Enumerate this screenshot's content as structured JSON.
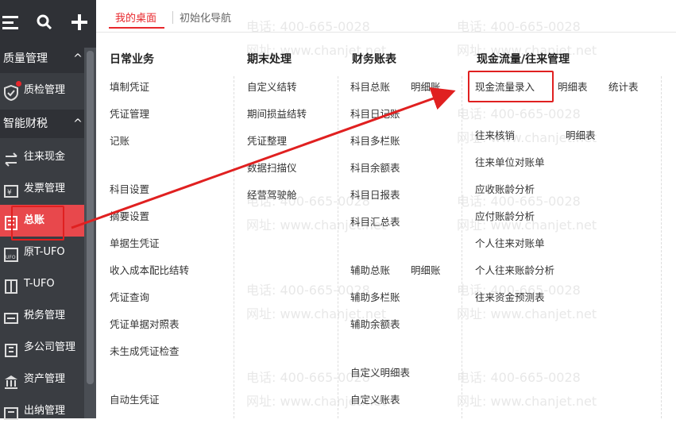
{
  "sidebar": {
    "sections": [
      {
        "label": "质量管理",
        "chevron": "^"
      },
      {
        "label": "智能财税",
        "chevron": "^"
      }
    ],
    "items": [
      {
        "label": "质检管理",
        "icon": "shield-check-icon"
      },
      {
        "label": "往来现金",
        "icon": "exchange-icon"
      },
      {
        "label": "发票管理",
        "icon": "invoice-icon"
      },
      {
        "label": "总账",
        "icon": "ledger-icon"
      },
      {
        "label": "原T-UFO",
        "icon": "ufo-icon"
      },
      {
        "label": "T-UFO",
        "icon": "tufo-icon"
      },
      {
        "label": "税务管理",
        "icon": "tax-icon"
      },
      {
        "label": "多公司管理",
        "icon": "company-icon"
      },
      {
        "label": "资产管理",
        "icon": "asset-icon"
      },
      {
        "label": "出纳管理",
        "icon": "cashier-icon"
      }
    ]
  },
  "tabs": {
    "active": "我的桌面",
    "other": "初始化导航"
  },
  "columns": {
    "daily": {
      "title": "日常业务",
      "items": [
        "填制凭证",
        "凭证管理",
        "记账",
        "科目设置",
        "摘要设置",
        "单据生凭证",
        "收入成本配比结转",
        "凭证查询",
        "凭证单据对照表",
        "未生成凭证检查",
        "自动生凭证"
      ]
    },
    "period": {
      "title": "期末处理",
      "items": [
        "自定义结转",
        "期间损益结转",
        "凭证整理",
        "数据扫描仪",
        "经营驾驶舱"
      ]
    },
    "books": {
      "title": "财务账表",
      "items": [
        "科目总账",
        "明细账",
        "科目日记账",
        "科目多栏账",
        "科目余额表",
        "科目日报表",
        "科目汇总表",
        "辅助总账",
        "明细账",
        "辅助多栏账",
        "辅助余额表",
        "自定义明细表",
        "自定义账表"
      ]
    },
    "cashflow": {
      "title": "现金流量/往来管理",
      "items": [
        "现金流量录入",
        "明细表",
        "统计表",
        "往来核销",
        "明细表",
        "往来单位对账单",
        "应收账龄分析",
        "应付账龄分析",
        "个人往来对账单",
        "个人往来账龄分析",
        "往来资金预测表"
      ]
    }
  },
  "watermark": {
    "phone": "电话: 400-665-0028",
    "site": "网址: www.chanjet.net"
  },
  "colors": {
    "accent": "#e8272c",
    "sidebar": "#3a3d42",
    "active_item": "#e8484c"
  }
}
